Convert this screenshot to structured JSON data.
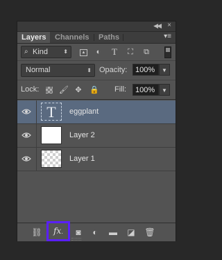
{
  "tabs": [
    {
      "label": "Layers",
      "active": true
    },
    {
      "label": "Channels",
      "active": false
    },
    {
      "label": "Paths",
      "active": false
    }
  ],
  "filter": {
    "kind_label": "Kind",
    "icons": [
      "image-filter-icon",
      "adjustment-filter-icon",
      "type-filter-icon",
      "shape-filter-icon",
      "smart-object-filter-icon"
    ]
  },
  "blend": {
    "mode": "Normal",
    "opacity_label": "Opacity:",
    "opacity_value": "100%"
  },
  "lock": {
    "label": "Lock:",
    "fill_label": "Fill:",
    "fill_value": "100%"
  },
  "layers": [
    {
      "name": "eggplant",
      "type": "text",
      "selected": true,
      "thumb_glyph": "T"
    },
    {
      "name": "Layer 2",
      "type": "white",
      "selected": false
    },
    {
      "name": "Layer 1",
      "type": "transparent",
      "selected": false
    }
  ],
  "bottom": {
    "fx_label": "fx",
    "highlight_color": "#5a1fff"
  },
  "colors": {
    "panel": "#535353",
    "selected_row": "#5a6a80",
    "background": "#282828"
  }
}
